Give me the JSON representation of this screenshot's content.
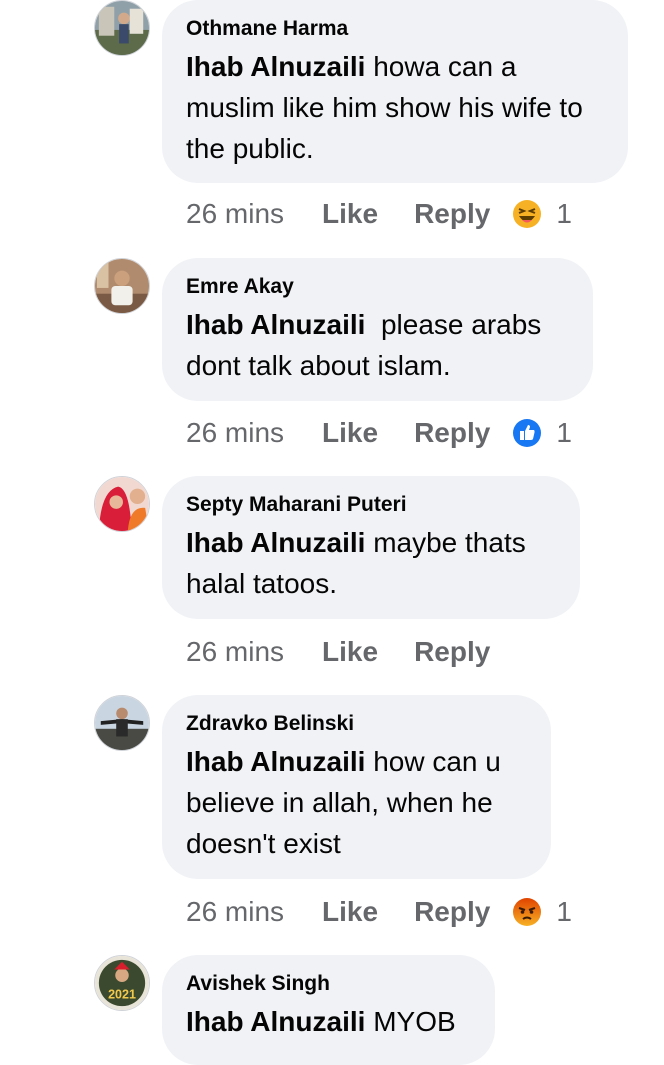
{
  "comments": [
    {
      "author": "Othmane Harma",
      "mention": "Ihab Alnuzaili",
      "text": " howa can a muslim like him show his wife to the public.",
      "time": "26 mins",
      "like": "Like",
      "reply": "Reply",
      "reaction_icon": "haha-emoji-icon",
      "reaction_count": "1"
    },
    {
      "author": "Emre Akay",
      "mention": "Ihab Alnuzaili",
      "text": "  please arabs dont talk about islam.",
      "time": "26 mins",
      "like": "Like",
      "reply": "Reply",
      "reaction_icon": "like-thumb-icon",
      "reaction_count": "1"
    },
    {
      "author": "Septy Maharani Puteri",
      "mention": "Ihab Alnuzaili",
      "text": " maybe thats halal tatoos.",
      "time": "26 mins",
      "like": "Like",
      "reply": "Reply"
    },
    {
      "author": "Zdravko Belinski",
      "mention": "Ihab Alnuzaili",
      "text": " how can u believe in allah, when he doesn't exist",
      "time": "26 mins",
      "like": "Like",
      "reply": "Reply",
      "reaction_icon": "angry-emoji-icon",
      "reaction_count": "1"
    },
    {
      "author": "Avishek Singh",
      "mention": "Ihab Alnuzaili",
      "text": " MYOB"
    }
  ],
  "colors": {
    "bubble": "#f0f2f5",
    "secondary_text": "#65676b",
    "like_blue": "#1877f2",
    "haha_yellow": "#f7b125",
    "angry_orange": "#e9710f"
  }
}
